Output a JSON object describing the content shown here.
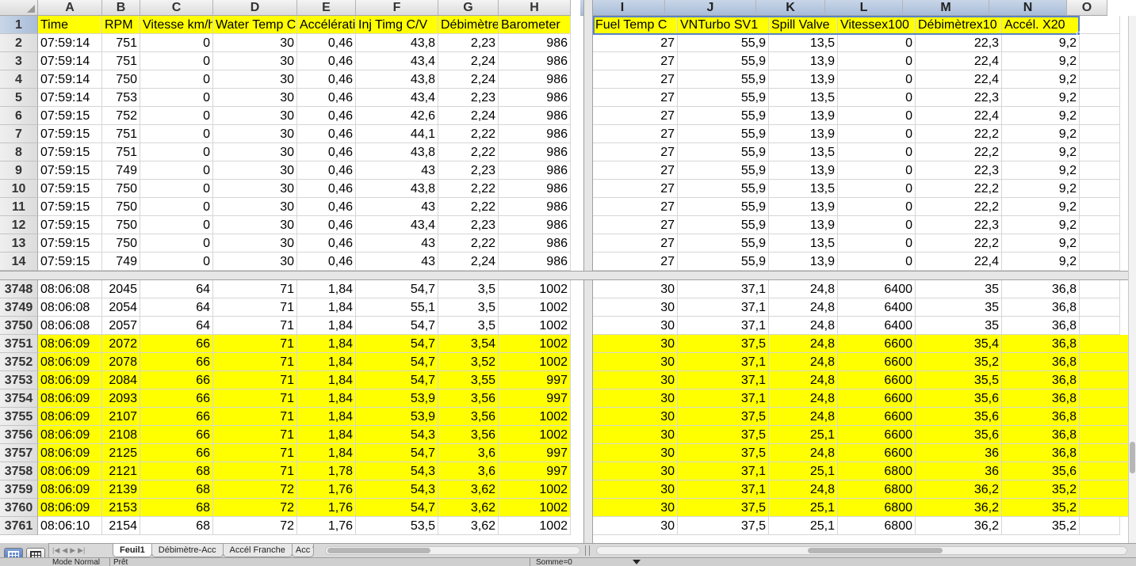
{
  "columns": [
    "A",
    "B",
    "C",
    "D",
    "E",
    "F",
    "G",
    "H",
    "I",
    "J",
    "K",
    "L",
    "M",
    "N",
    "O"
  ],
  "headers_left": [
    "Time",
    "RPM",
    "Vitesse km/h",
    "Water Temp C",
    "Accélération",
    "Inj Timg C/V",
    "Débimètre",
    "Barometer"
  ],
  "headers_right": [
    "Fuel Temp C",
    "VNTurbo SV1",
    "Spill Valve",
    "Vitessex100",
    "Débimètrex10",
    "Accél. X20"
  ],
  "rows_top": [
    {
      "n": "2",
      "v": [
        "07:59:14",
        "751",
        "0",
        "30",
        "0,46",
        "43,8",
        "2,23",
        "986",
        "27",
        "55,9",
        "13,5",
        "0",
        "22,3",
        "9,2"
      ]
    },
    {
      "n": "3",
      "v": [
        "07:59:14",
        "751",
        "0",
        "30",
        "0,46",
        "43,4",
        "2,24",
        "986",
        "27",
        "55,9",
        "13,9",
        "0",
        "22,4",
        "9,2"
      ]
    },
    {
      "n": "4",
      "v": [
        "07:59:14",
        "750",
        "0",
        "30",
        "0,46",
        "43,8",
        "2,24",
        "986",
        "27",
        "55,9",
        "13,9",
        "0",
        "22,4",
        "9,2"
      ]
    },
    {
      "n": "5",
      "v": [
        "07:59:14",
        "753",
        "0",
        "30",
        "0,46",
        "43,4",
        "2,23",
        "986",
        "27",
        "55,9",
        "13,5",
        "0",
        "22,3",
        "9,2"
      ]
    },
    {
      "n": "6",
      "v": [
        "07:59:15",
        "752",
        "0",
        "30",
        "0,46",
        "42,6",
        "2,24",
        "986",
        "27",
        "55,9",
        "13,9",
        "0",
        "22,4",
        "9,2"
      ]
    },
    {
      "n": "7",
      "v": [
        "07:59:15",
        "751",
        "0",
        "30",
        "0,46",
        "44,1",
        "2,22",
        "986",
        "27",
        "55,9",
        "13,9",
        "0",
        "22,2",
        "9,2"
      ]
    },
    {
      "n": "8",
      "v": [
        "07:59:15",
        "751",
        "0",
        "30",
        "0,46",
        "43,8",
        "2,22",
        "986",
        "27",
        "55,9",
        "13,5",
        "0",
        "22,2",
        "9,2"
      ]
    },
    {
      "n": "9",
      "v": [
        "07:59:15",
        "749",
        "0",
        "30",
        "0,46",
        "43",
        "2,23",
        "986",
        "27",
        "55,9",
        "13,9",
        "0",
        "22,3",
        "9,2"
      ]
    },
    {
      "n": "10",
      "v": [
        "07:59:15",
        "750",
        "0",
        "30",
        "0,46",
        "43,8",
        "2,22",
        "986",
        "27",
        "55,9",
        "13,5",
        "0",
        "22,2",
        "9,2"
      ]
    },
    {
      "n": "11",
      "v": [
        "07:59:15",
        "750",
        "0",
        "30",
        "0,46",
        "43",
        "2,22",
        "986",
        "27",
        "55,9",
        "13,9",
        "0",
        "22,2",
        "9,2"
      ]
    },
    {
      "n": "12",
      "v": [
        "07:59:15",
        "750",
        "0",
        "30",
        "0,46",
        "43,4",
        "2,23",
        "986",
        "27",
        "55,9",
        "13,9",
        "0",
        "22,3",
        "9,2"
      ]
    },
    {
      "n": "13",
      "v": [
        "07:59:15",
        "750",
        "0",
        "30",
        "0,46",
        "43",
        "2,22",
        "986",
        "27",
        "55,9",
        "13,5",
        "0",
        "22,2",
        "9,2"
      ]
    },
    {
      "n": "14",
      "v": [
        "07:59:15",
        "749",
        "0",
        "30",
        "0,46",
        "43",
        "2,24",
        "986",
        "27",
        "55,9",
        "13,9",
        "0",
        "22,4",
        "9,2"
      ]
    }
  ],
  "rows_bottom": [
    {
      "n": "3748",
      "hl": false,
      "v": [
        "08:06:08",
        "2045",
        "64",
        "71",
        "1,84",
        "54,7",
        "3,5",
        "1002",
        "30",
        "37,1",
        "24,8",
        "6400",
        "35",
        "36,8"
      ]
    },
    {
      "n": "3749",
      "hl": false,
      "v": [
        "08:06:08",
        "2054",
        "64",
        "71",
        "1,84",
        "55,1",
        "3,5",
        "1002",
        "30",
        "37,1",
        "24,8",
        "6400",
        "35",
        "36,8"
      ]
    },
    {
      "n": "3750",
      "hl": false,
      "v": [
        "08:06:08",
        "2057",
        "64",
        "71",
        "1,84",
        "54,7",
        "3,5",
        "1002",
        "30",
        "37,1",
        "24,8",
        "6400",
        "35",
        "36,8"
      ]
    },
    {
      "n": "3751",
      "hl": true,
      "v": [
        "08:06:09",
        "2072",
        "66",
        "71",
        "1,84",
        "54,7",
        "3,54",
        "1002",
        "30",
        "37,5",
        "24,8",
        "6600",
        "35,4",
        "36,8"
      ]
    },
    {
      "n": "3752",
      "hl": true,
      "v": [
        "08:06:09",
        "2078",
        "66",
        "71",
        "1,84",
        "54,7",
        "3,52",
        "1002",
        "30",
        "37,1",
        "24,8",
        "6600",
        "35,2",
        "36,8"
      ]
    },
    {
      "n": "3753",
      "hl": true,
      "v": [
        "08:06:09",
        "2084",
        "66",
        "71",
        "1,84",
        "54,7",
        "3,55",
        "997",
        "30",
        "37,1",
        "24,8",
        "6600",
        "35,5",
        "36,8"
      ]
    },
    {
      "n": "3754",
      "hl": true,
      "v": [
        "08:06:09",
        "2093",
        "66",
        "71",
        "1,84",
        "53,9",
        "3,56",
        "997",
        "30",
        "37,1",
        "24,8",
        "6600",
        "35,6",
        "36,8"
      ]
    },
    {
      "n": "3755",
      "hl": true,
      "v": [
        "08:06:09",
        "2107",
        "66",
        "71",
        "1,84",
        "53,9",
        "3,56",
        "1002",
        "30",
        "37,5",
        "24,8",
        "6600",
        "35,6",
        "36,8"
      ]
    },
    {
      "n": "3756",
      "hl": true,
      "v": [
        "08:06:09",
        "2108",
        "66",
        "71",
        "1,84",
        "54,3",
        "3,56",
        "1002",
        "30",
        "37,5",
        "25,1",
        "6600",
        "35,6",
        "36,8"
      ]
    },
    {
      "n": "3757",
      "hl": true,
      "v": [
        "08:06:09",
        "2125",
        "66",
        "71",
        "1,84",
        "54,7",
        "3,6",
        "997",
        "30",
        "37,5",
        "24,8",
        "6600",
        "36",
        "36,8"
      ]
    },
    {
      "n": "3758",
      "hl": true,
      "v": [
        "08:06:09",
        "2121",
        "68",
        "71",
        "1,78",
        "54,3",
        "3,6",
        "997",
        "30",
        "37,1",
        "25,1",
        "6800",
        "36",
        "35,6"
      ]
    },
    {
      "n": "3759",
      "hl": true,
      "v": [
        "08:06:09",
        "2139",
        "68",
        "72",
        "1,76",
        "54,3",
        "3,62",
        "1002",
        "30",
        "37,1",
        "24,8",
        "6800",
        "36,2",
        "35,2"
      ]
    },
    {
      "n": "3760",
      "hl": true,
      "v": [
        "08:06:09",
        "2153",
        "68",
        "72",
        "1,76",
        "54,7",
        "3,62",
        "1002",
        "30",
        "37,5",
        "25,1",
        "6800",
        "36,2",
        "35,2"
      ]
    },
    {
      "n": "3761",
      "hl": false,
      "v": [
        "08:06:10",
        "2154",
        "68",
        "72",
        "1,76",
        "53,5",
        "3,62",
        "1002",
        "30",
        "37,5",
        "25,1",
        "6800",
        "36,2",
        "35,2"
      ]
    }
  ],
  "tabs": [
    "Feuil1",
    "Débimètre-Acc",
    "Accél Franche",
    "Acc V"
  ],
  "active_tab": "Feuil1",
  "status": {
    "mode": "Mode Normal",
    "ready": "Prêt",
    "sum": "Somme=0"
  },
  "colors": {
    "highlight": "#ffff00",
    "selection": "#5a82c8"
  }
}
